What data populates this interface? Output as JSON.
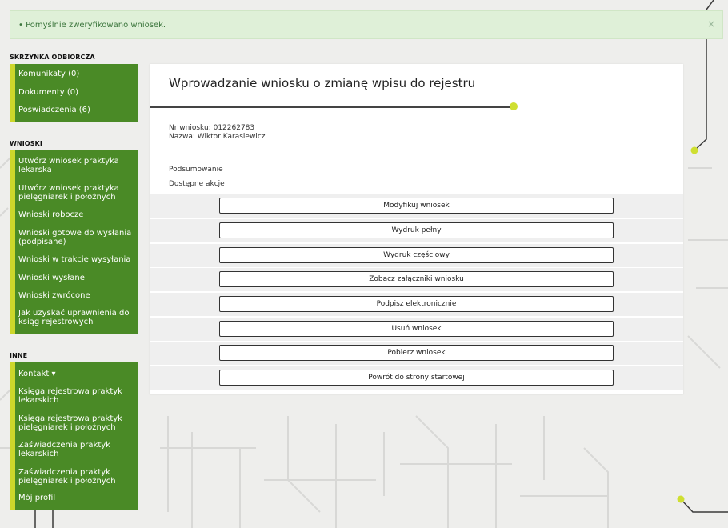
{
  "colors": {
    "menu_bg": "#4a8a26",
    "menu_accent": "#cdd72b",
    "alert_bg": "#dff0d8",
    "alert_text": "#3c763d"
  },
  "alert": {
    "message": "• Pomyślnie zweryfikowano wniosek.",
    "close": "×"
  },
  "sidebar": {
    "inbox": {
      "title": "SKRZYNKA ODBIORCZA",
      "items": [
        "Komunikaty (0)",
        "Dokumenty (0)",
        "Poświadczenia (6)"
      ]
    },
    "applications": {
      "title": "WNIOSKI",
      "items": [
        "Utwórz wniosek praktyka lekarska",
        "Utwórz wniosek praktyka pielęgniarek i położnych",
        "Wnioski robocze",
        "Wnioski gotowe do wysłania (podpisane)",
        "Wnioski w trakcie wysyłania",
        "Wnioski wysłane",
        "Wnioski zwrócone",
        "Jak uzyskać uprawnienia do ksiąg rejestrowych"
      ]
    },
    "other": {
      "title": "INNE",
      "items": [
        "Kontakt ▾",
        "Księga rejestrowa praktyk lekarskich",
        "Księga rejestrowa praktyk pielęgniarek i położnych",
        "Zaświadczenia praktyk lekarskich",
        "Zaświadczenia praktyk pielęgniarek i położnych",
        "Mój profil"
      ]
    }
  },
  "main": {
    "title": "Wprowadzanie wniosku o zmianę wpisu do rejestru",
    "application_no": "Nr wniosku: 012262783",
    "name": "Nazwa: Wiktor Karasiewicz",
    "summary_label": "Podsumowanie",
    "actions_label": "Dostępne akcje",
    "actions": [
      "Modyfikuj wniosek",
      "Wydruk pełny",
      "Wydruk częściowy",
      "Zobacz załączniki wniosku",
      "Podpisz elektronicznie",
      "Usuń wniosek",
      "Pobierz wniosek",
      "Powrót do strony startowej"
    ]
  }
}
